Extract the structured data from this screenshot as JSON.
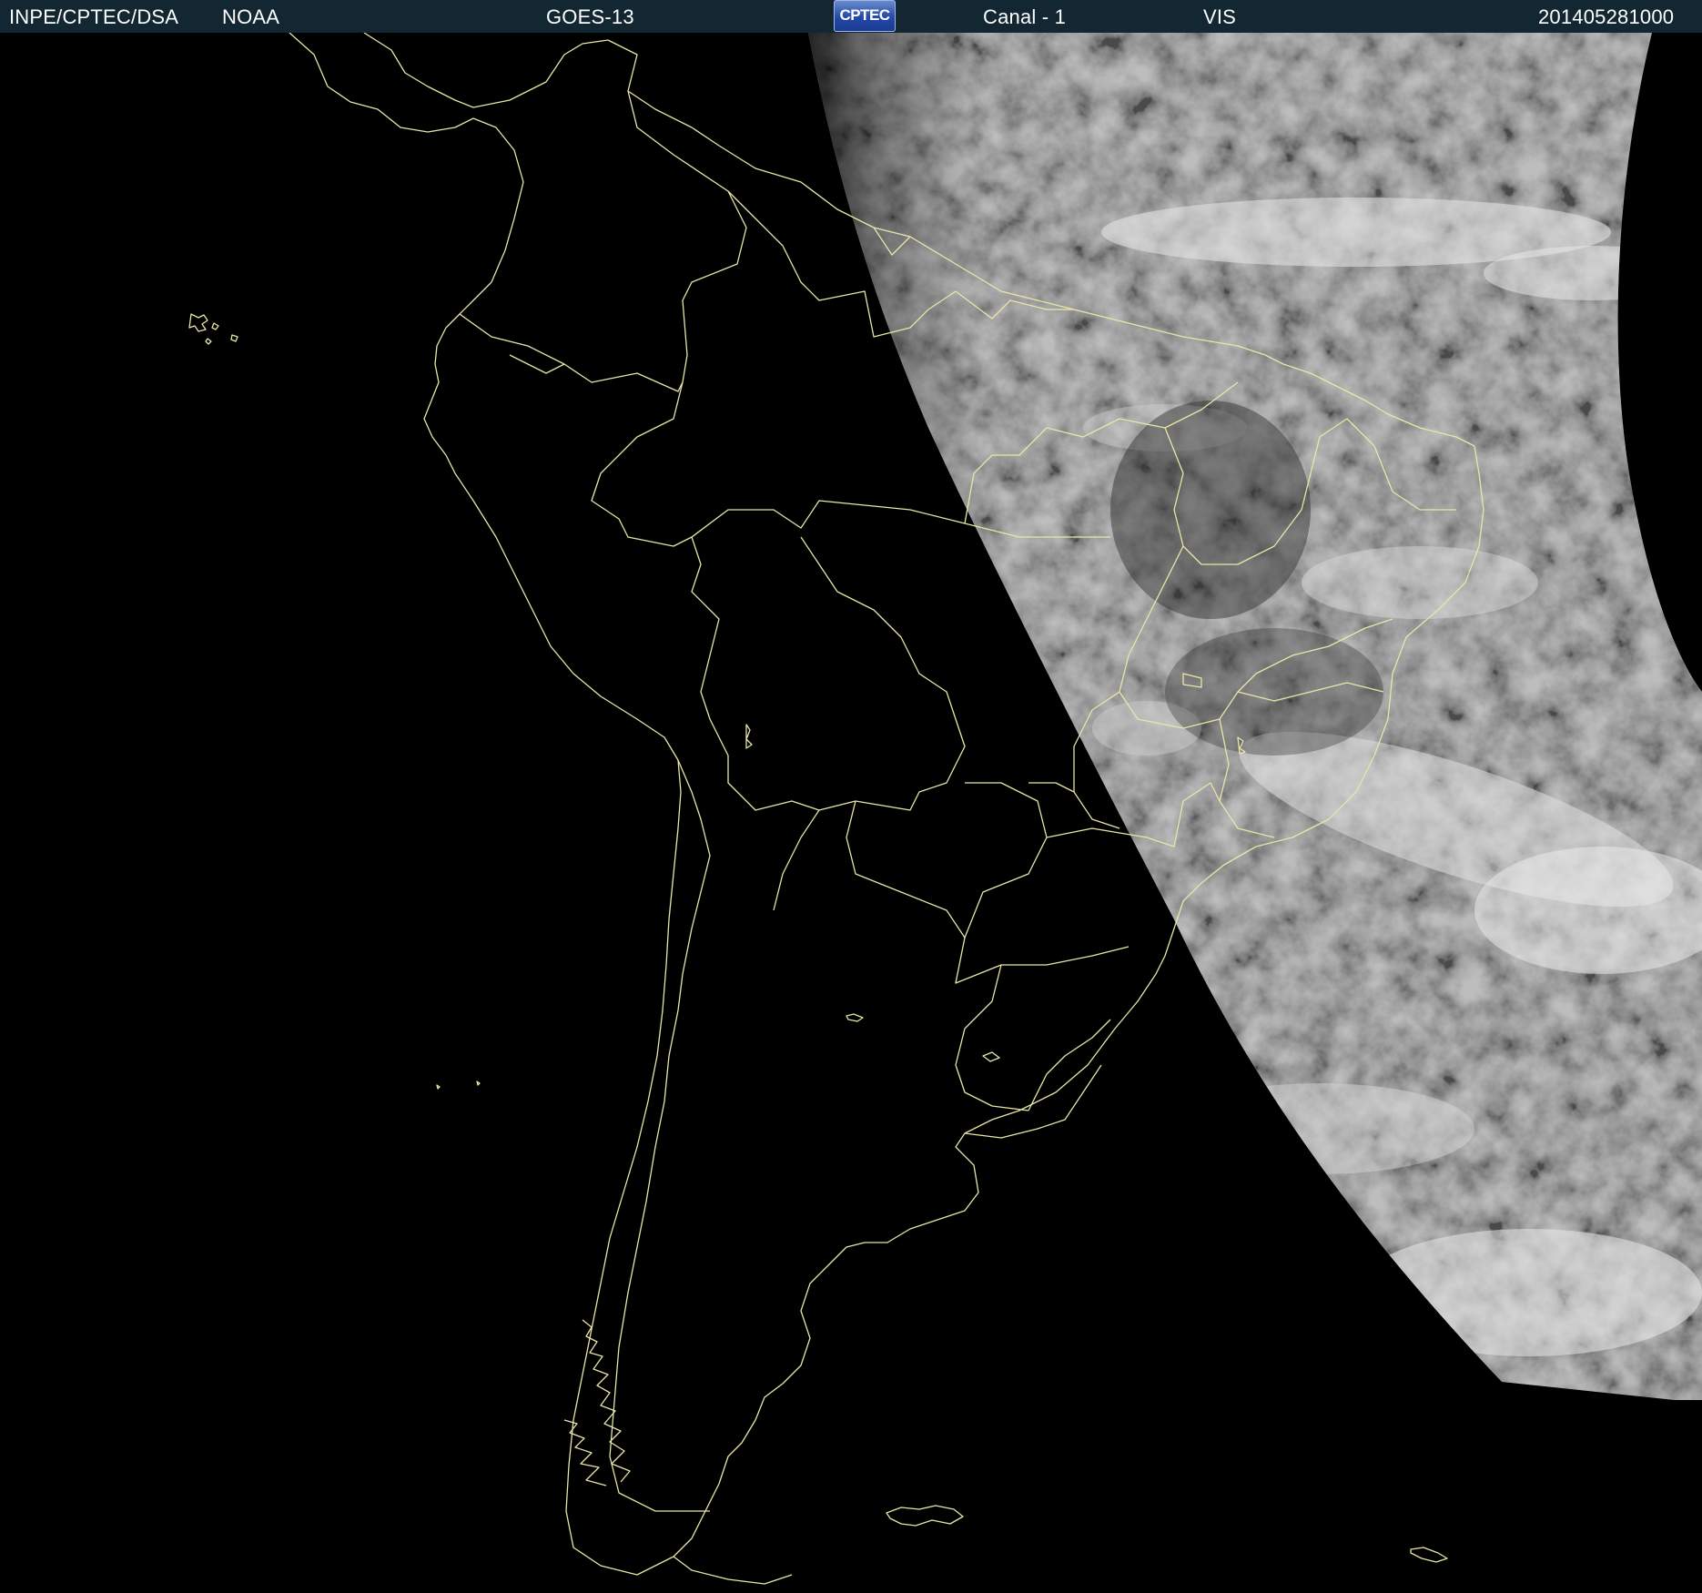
{
  "header": {
    "source": "INPE/CPTEC/DSA",
    "agency": "NOAA",
    "satellite": "GOES-13",
    "logo_text": "CPTEC",
    "channel": "Canal - 1",
    "band": "VIS",
    "timestamp": "201405281000",
    "background_color": "#132733"
  },
  "map": {
    "region": "South America",
    "projection": "satellite view",
    "night_color": "#000000",
    "coastline_color": "#e8e6a8",
    "illumination": "day side east of terminator, night side west"
  }
}
